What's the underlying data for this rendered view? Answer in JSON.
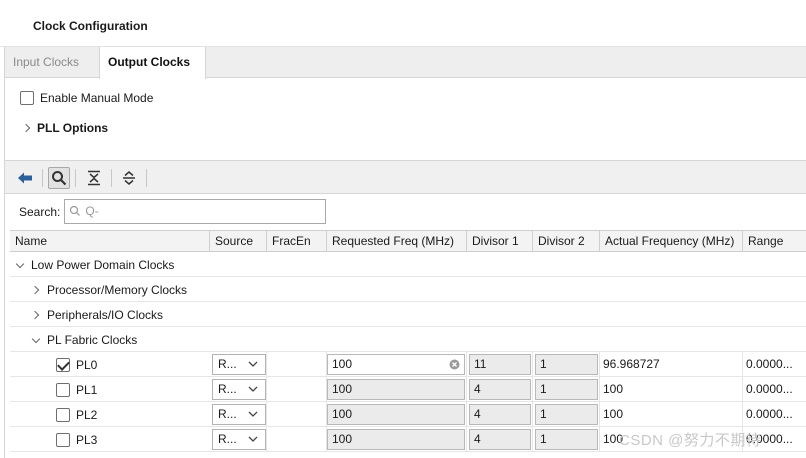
{
  "header": {
    "title": "Clock Configuration"
  },
  "tabs": [
    {
      "label": "Input Clocks",
      "active": false
    },
    {
      "label": "Output Clocks",
      "active": true
    }
  ],
  "options": {
    "manual_mode_label": "Enable Manual Mode",
    "manual_mode_checked": false,
    "pll_options_label": "PLL Options"
  },
  "toolbar": {
    "icons": [
      "back-arrow-icon",
      "search-icon",
      "collapse-all-icon",
      "expand-all-icon"
    ]
  },
  "search": {
    "label": "Search:",
    "placeholder": "Q-"
  },
  "table": {
    "columns": [
      "Name",
      "Source",
      "FracEn",
      "Requested Freq (MHz)",
      "Divisor 1",
      "Divisor 2",
      "Actual Frequency (MHz)",
      "Range"
    ],
    "groups": [
      {
        "label": "Low Power Domain Clocks",
        "expanded": true
      },
      {
        "label": "Processor/Memory Clocks",
        "expanded": false
      },
      {
        "label": "Peripherals/IO Clocks",
        "expanded": false
      },
      {
        "label": "PL Fabric Clocks",
        "expanded": true
      }
    ],
    "rows": [
      {
        "name": "PL0",
        "checked": true,
        "source": "R...",
        "requested": "100",
        "div1": "11",
        "div2": "1",
        "actual": "96.968727",
        "range": "0.0000..."
      },
      {
        "name": "PL1",
        "checked": false,
        "source": "R...",
        "requested": "100",
        "div1": "4",
        "div2": "1",
        "actual": "100",
        "range": "0.0000..."
      },
      {
        "name": "PL2",
        "checked": false,
        "source": "R...",
        "requested": "100",
        "div1": "4",
        "div2": "1",
        "actual": "100",
        "range": "0.0000..."
      },
      {
        "name": "PL3",
        "checked": false,
        "source": "R...",
        "requested": "100",
        "div1": "4",
        "div2": "1",
        "actual": "100",
        "range": "0.0000..."
      }
    ]
  },
  "watermark": "CSDN @努力不期待",
  "colors": {
    "accent": "#2d5f9a",
    "checkbox_border": "#6f6f6f",
    "readonly_bg": "#ebebeb"
  }
}
